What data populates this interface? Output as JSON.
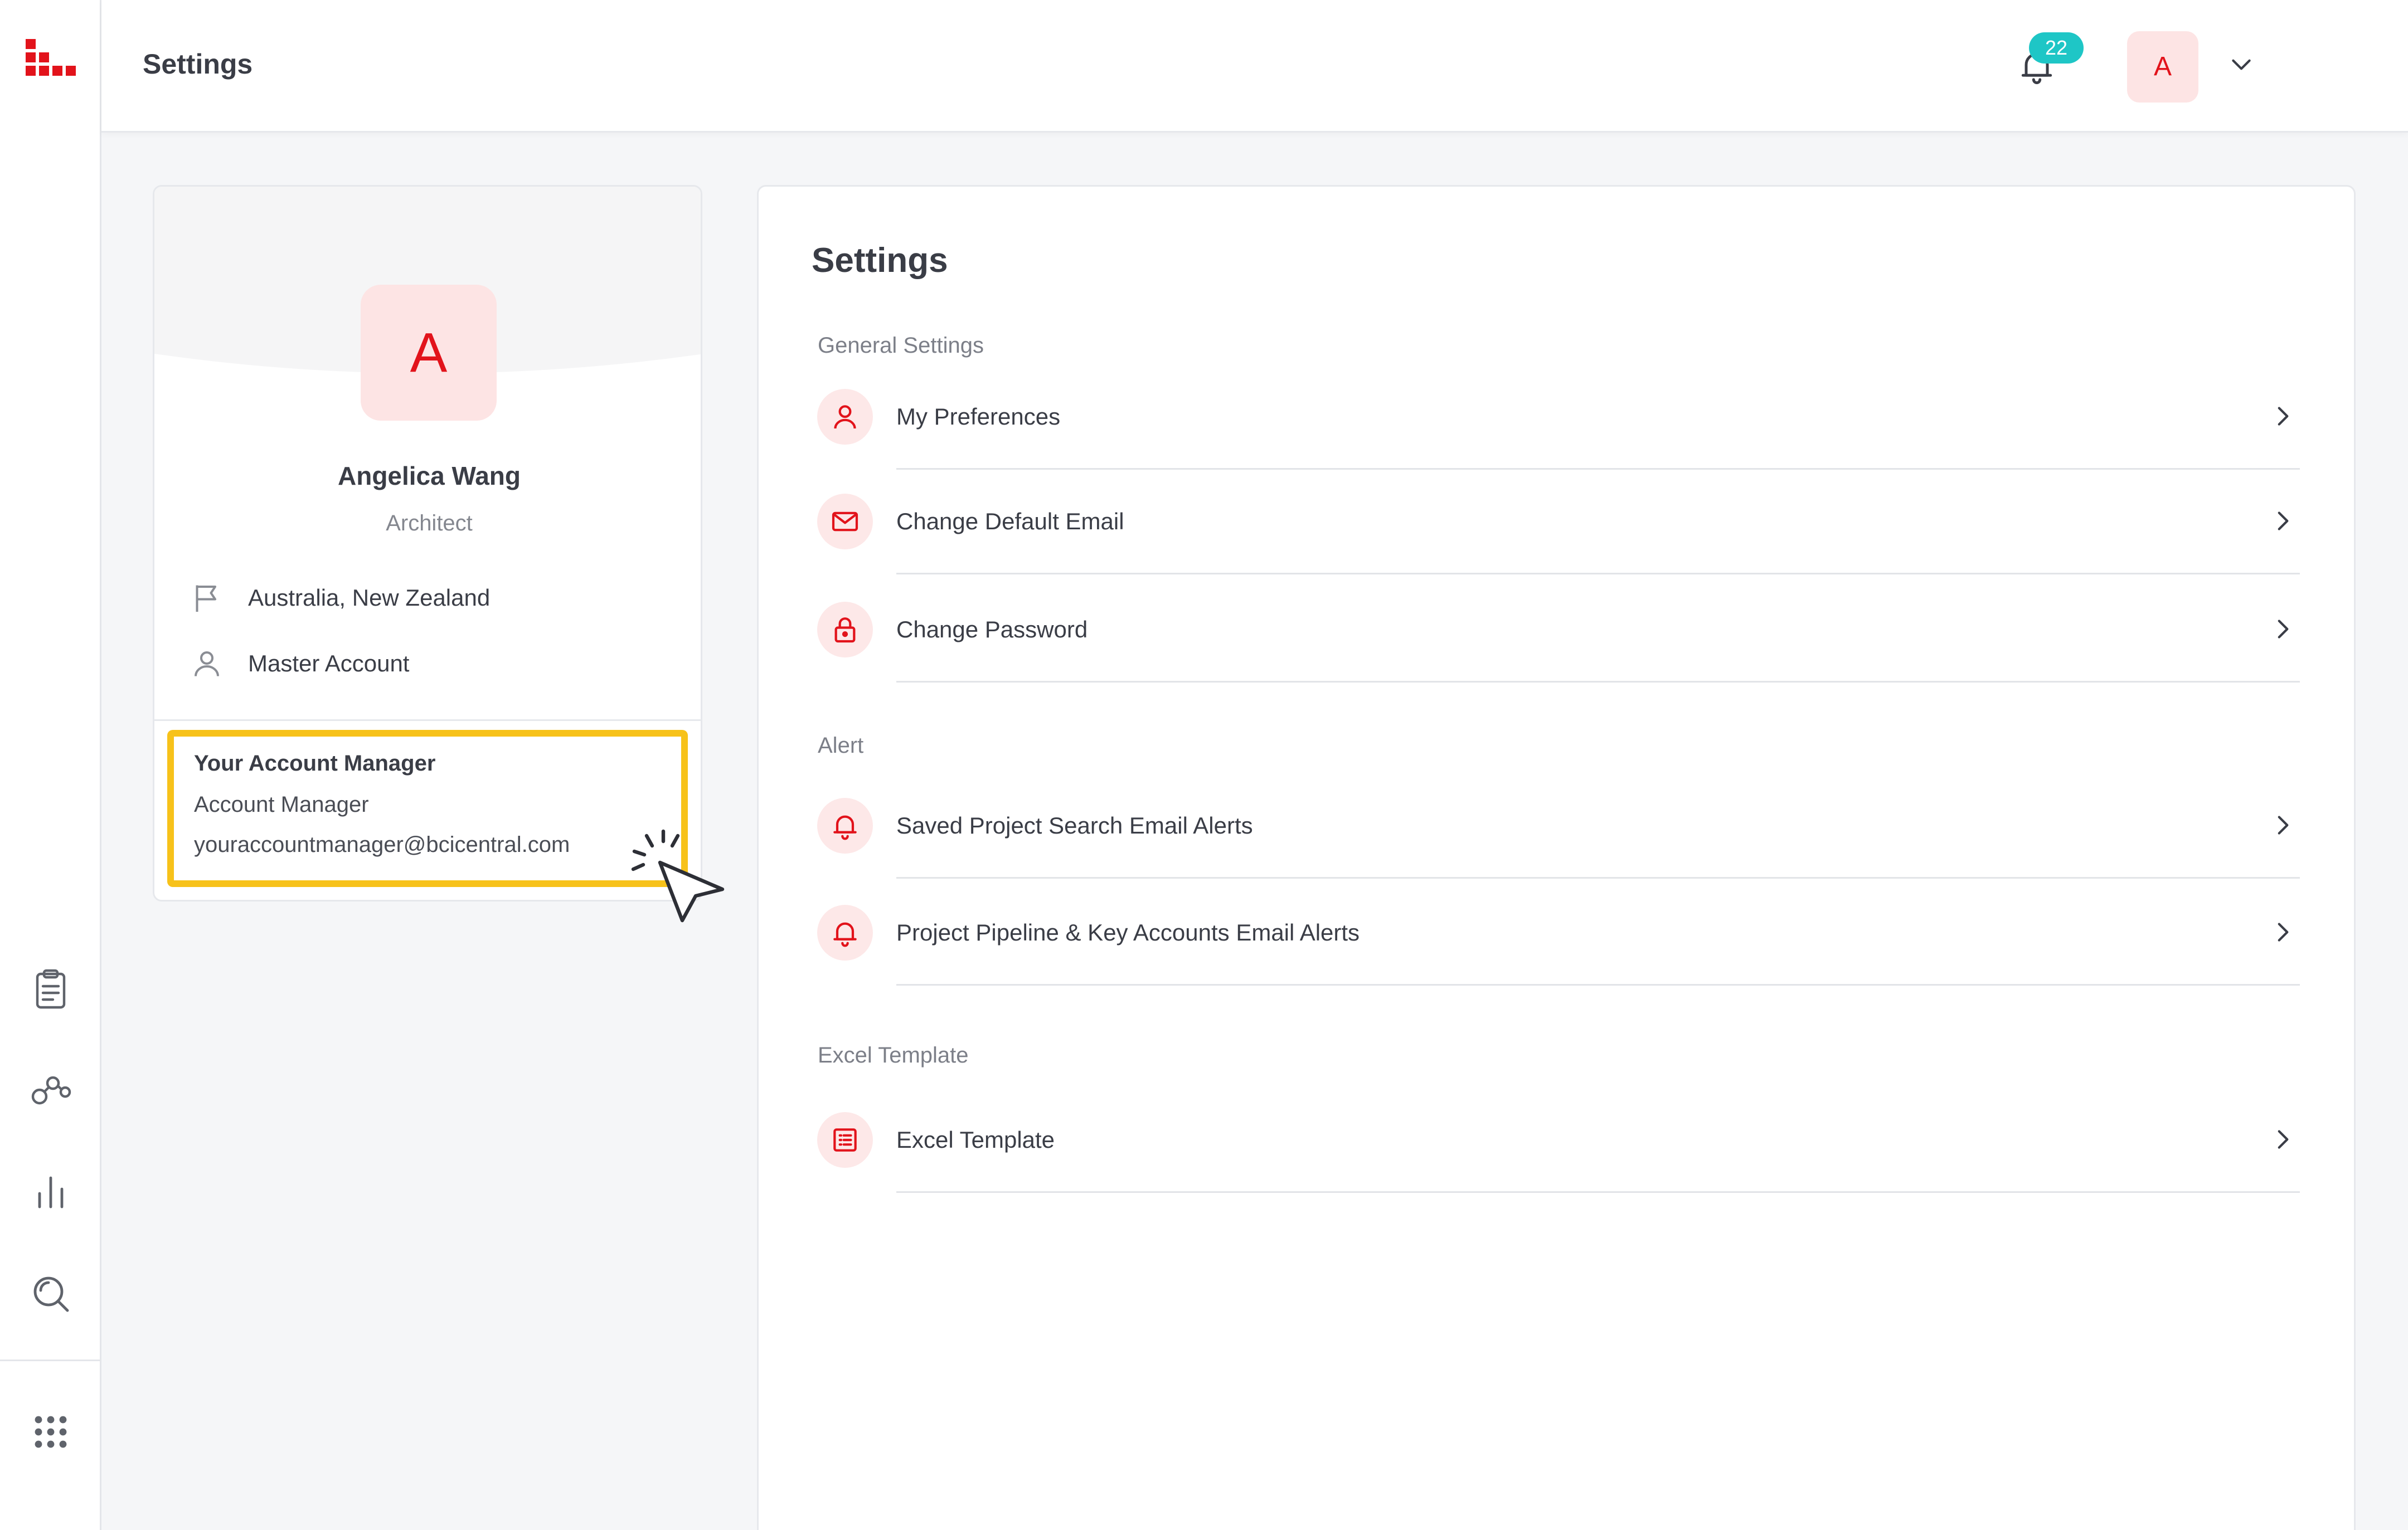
{
  "header": {
    "title": "Settings",
    "notification_count": "22",
    "user_initial": "A"
  },
  "profile": {
    "initial": "A",
    "name": "Angelica Wang",
    "role": "Architect",
    "region": "Australia, New Zealand",
    "account_type": "Master Account"
  },
  "account_manager": {
    "heading": "Your Account Manager",
    "name": "Account Manager",
    "email": "youraccountmanager@bcicentral.com"
  },
  "settings": {
    "title": "Settings",
    "sections": [
      {
        "label": "General Settings",
        "items": [
          {
            "label": "My Preferences",
            "icon": "user-icon"
          },
          {
            "label": "Change Default Email",
            "icon": "mail-icon"
          },
          {
            "label": "Change Password",
            "icon": "lock-icon"
          }
        ]
      },
      {
        "label": "Alert",
        "items": [
          {
            "label": "Saved Project Search Email Alerts",
            "icon": "bell-icon"
          },
          {
            "label": "Project Pipeline & Key Accounts Email Alerts",
            "icon": "bell-icon"
          }
        ]
      },
      {
        "label": "Excel Template",
        "items": [
          {
            "label": "Excel Template",
            "icon": "list-icon"
          }
        ]
      }
    ]
  },
  "colors": {
    "accent": "#e2131b",
    "accent_soft": "#fde8e8",
    "badge": "#1ec6c6",
    "highlight": "#f7c21a"
  }
}
